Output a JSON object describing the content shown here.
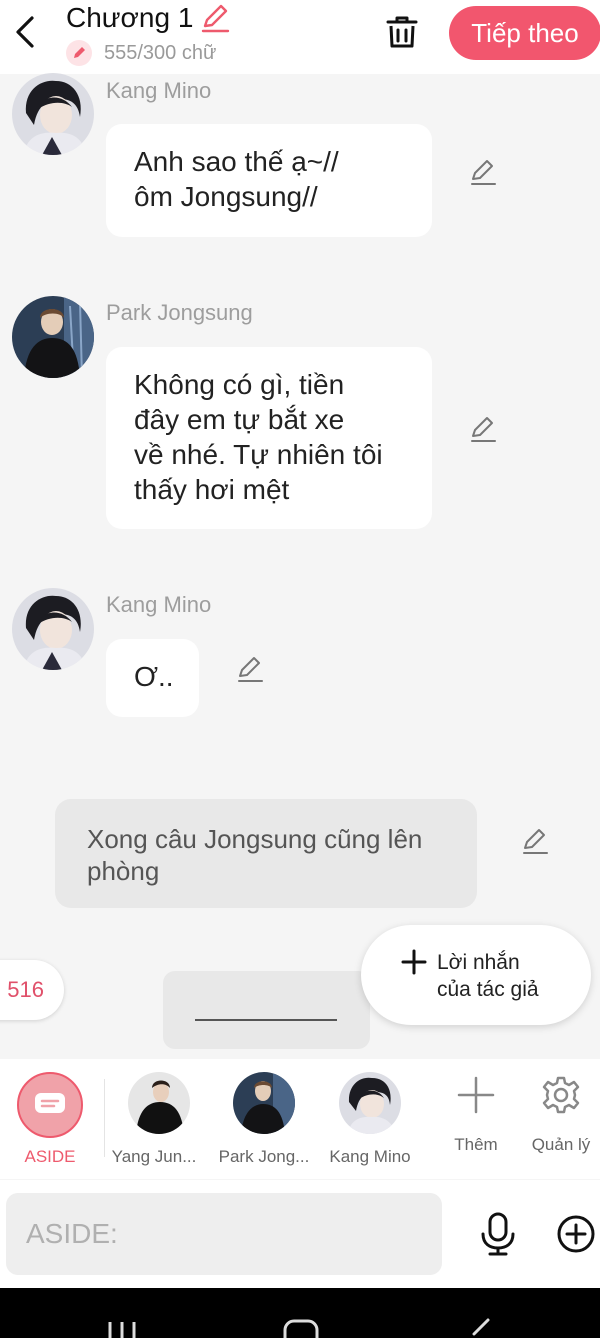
{
  "header": {
    "title": "Chương 1",
    "word_count": "555/300 chữ",
    "next_label": "Tiếp theo"
  },
  "messages": [
    {
      "name": "Kang Mino",
      "text_lines": [
        "Anh sao thế ạ~//",
        "ôm Jongsung//"
      ]
    },
    {
      "name": "Park Jongsung",
      "text_lines": [
        "Không có gì, tiền",
        "đây em tự bắt xe",
        "về nhé. Tự nhiên tôi",
        "thấy hơi mệt"
      ]
    },
    {
      "name": "Kang Mino",
      "text_lines": [
        "Ơ.."
      ]
    }
  ],
  "narration": {
    "text_lines": [
      "Xong câu Jongsung cũng lên",
      "phòng"
    ]
  },
  "floating": {
    "count": "516",
    "author_note_lines": [
      "Lời nhắn",
      "của tác giả"
    ]
  },
  "character_bar": {
    "aside_label": "ASIDE",
    "characters": [
      "Yang Jun...",
      "Park Jong...",
      "Kang Mino"
    ],
    "add_label": "Thêm",
    "manage_label": "Quản lý"
  },
  "input": {
    "placeholder": "ASIDE:"
  },
  "colors": {
    "accent": "#f2566e",
    "aside_accent": "#ee5a6d"
  }
}
